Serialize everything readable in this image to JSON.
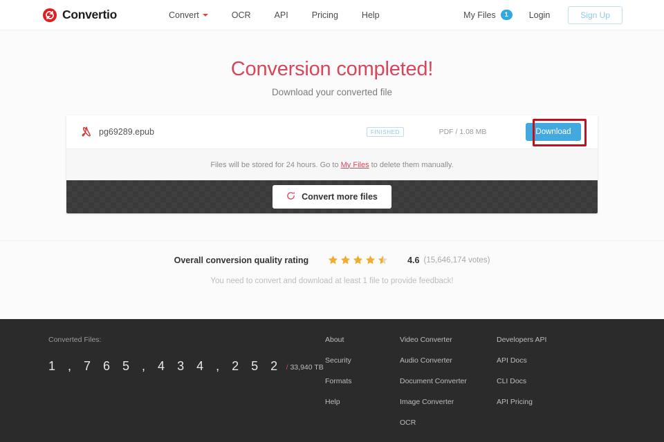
{
  "header": {
    "brand": "Convertio",
    "logo_icon": "convertio-logo-icon",
    "nav": [
      {
        "label": "Convert",
        "caret": true
      },
      {
        "label": "OCR",
        "caret": false
      },
      {
        "label": "API",
        "caret": false
      },
      {
        "label": "Pricing",
        "caret": false
      },
      {
        "label": "Help",
        "caret": false
      }
    ],
    "my_files_label": "My Files",
    "my_files_count": "1",
    "login_label": "Login",
    "signup_label": "Sign Up"
  },
  "hero": {
    "title": "Conversion completed!",
    "subtitle": "Download your converted file"
  },
  "card": {
    "file": {
      "icon": "pdf-file-icon",
      "name": "pg69289.epub",
      "status": "FINISHED",
      "meta": "PDF / 1.08 MB",
      "download_label": "Download"
    },
    "info_bar": {
      "text_before": "Files will be stored for 24 hours. Go to ",
      "link_label": "My Files",
      "text_after": " to delete them manually."
    },
    "convert_more_label": "Convert more files"
  },
  "rating": {
    "label": "Overall conversion quality rating",
    "stars_full": 4,
    "stars_half": 1,
    "stars_total": 5,
    "value": "4.6",
    "votes": "(15,646,174 votes)",
    "feedback_note": "You need to convert and download at least 1 file to provide feedback!",
    "star_color": "#f0ac2c"
  },
  "footer": {
    "counter_label": "Converted Files:",
    "counter_digits": "1 , 7 6 5 , 4 3 4 , 2 5 2",
    "counter_slash": "/",
    "counter_size": "33,940 TB",
    "columns": [
      {
        "links": [
          "About",
          "Security",
          "Formats",
          "Help"
        ]
      },
      {
        "links": [
          "Video Converter",
          "Audio Converter",
          "Document Converter",
          "Image Converter",
          "OCR"
        ]
      },
      {
        "links": [
          "Developers API",
          "API Docs",
          "CLI Docs",
          "API Pricing"
        ]
      }
    ]
  },
  "colors": {
    "brand_red": "#e02020",
    "hero_red": "#d6475b",
    "download_blue": "#42a8dd",
    "annotation_red": "#c0101b",
    "footer_bg": "#2b2b2b",
    "dark_band": "#3a3a3a"
  }
}
